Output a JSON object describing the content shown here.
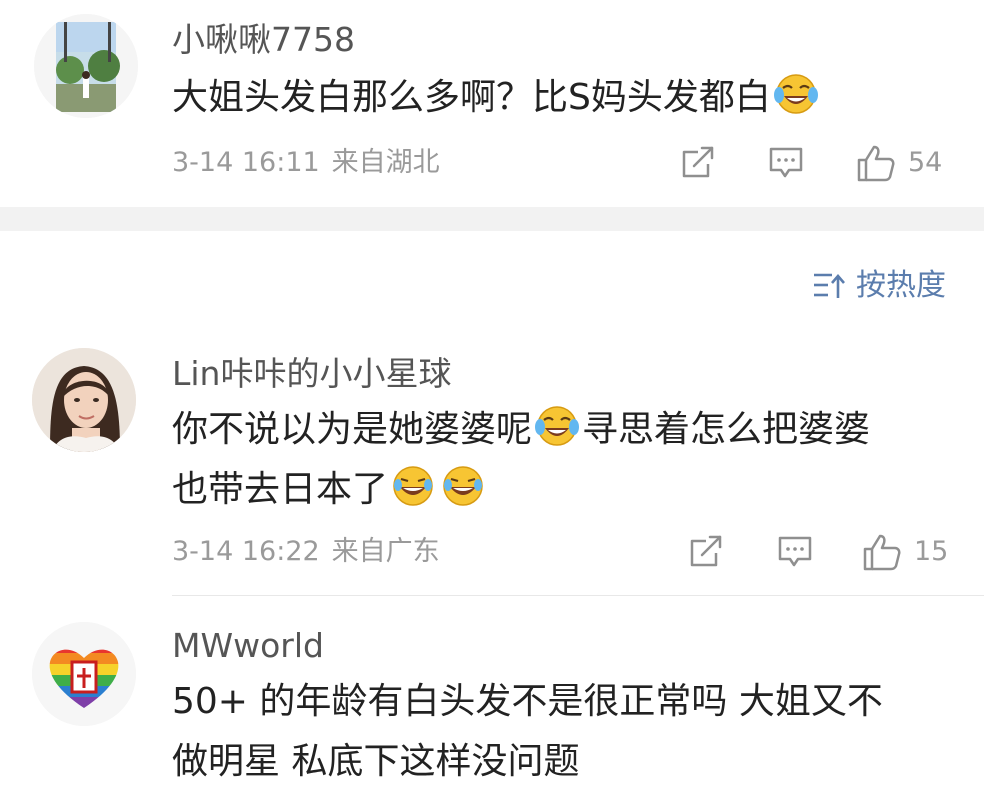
{
  "comments": [
    {
      "username": "小啾啾7758",
      "text_line1": "大姐头发白那么多啊？比S妈头发都白",
      "time": "3-14 16:11",
      "source": "来自湖北",
      "likes": "54",
      "emoji_name": "laugh-cry-emoji"
    },
    {
      "username": "Lin咔咔的小小星球",
      "text_part1": "你不说以为是她婆婆呢",
      "text_part2": "寻思着怎么把婆婆",
      "text_line2": "也带去日本了",
      "time": "3-14 16:22",
      "source": "来自广东",
      "likes": "15"
    },
    {
      "username": "MWworld",
      "text_line1": "50+ 的年龄有白头发不是很正常吗 大姐又不",
      "text_line2": "做明星 私底下这样没问题"
    }
  ],
  "sort": {
    "label": "按热度",
    "icon": "sort-icon"
  },
  "colors": {
    "accent": "#5b7dad",
    "meta_gray": "#9a9a9a",
    "separator": "#f2f2f2"
  }
}
